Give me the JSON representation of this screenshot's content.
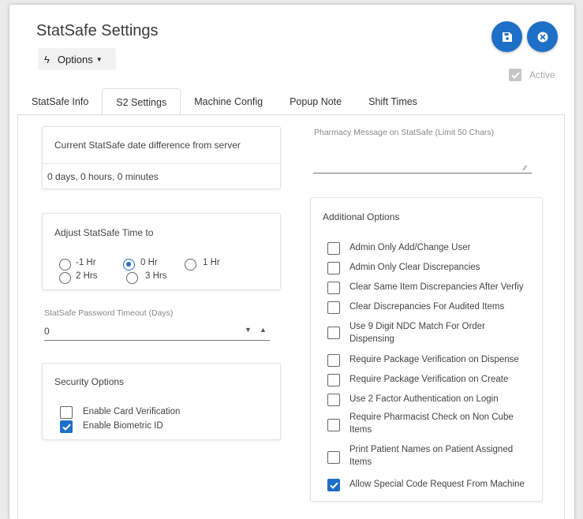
{
  "header": {
    "title": "StatSafe Settings",
    "options_label": "Options",
    "active_label": "Active"
  },
  "tabs": [
    {
      "label": "StatSafe Info"
    },
    {
      "label": "S2 Settings"
    },
    {
      "label": "Machine Config"
    },
    {
      "label": "Popup Note"
    },
    {
      "label": "Shift Times"
    }
  ],
  "date_diff": {
    "title": "Current StatSafe date difference from server",
    "value": "0 days, 0 hours, 0 minutes"
  },
  "adjust_time": {
    "title": "Adjust StatSafe Time to",
    "options": [
      "-1 Hr",
      "0 Hr",
      "1 Hr",
      "2 Hrs",
      "3 Hrs"
    ],
    "selected": "0 Hr"
  },
  "password_timeout": {
    "label": "StatSafe Password Timeout (Days)",
    "value": "0"
  },
  "security": {
    "title": "Security Options",
    "items": [
      {
        "label": "Enable Card Verification",
        "checked": false
      },
      {
        "label": "Enable Biometric ID",
        "checked": true
      }
    ]
  },
  "pharmacy_message": {
    "label": "Pharmacy Message on StatSafe (Limit 50 Chars)",
    "value": ""
  },
  "additional": {
    "title": "Additional Options",
    "items": [
      {
        "label": "Admin Only Add/Change User",
        "checked": false
      },
      {
        "label": "Admin Only Clear Discrepancies",
        "checked": false
      },
      {
        "label": "Clear Same Item Discrepancies After Verfiy",
        "checked": false
      },
      {
        "label": "Clear Discrepancies For Audited Items",
        "checked": false
      },
      {
        "label": "Use 9 Digit NDC Match For Order Dispensing",
        "checked": false
      },
      {
        "label": "Require Package Verification on Dispense",
        "checked": false
      },
      {
        "label": "Require Package Verification on Create",
        "checked": false
      },
      {
        "label": "Use 2 Factor Authentication on Login",
        "checked": false
      },
      {
        "label": "Require Pharmacist Check on Non Cube Items",
        "checked": false
      },
      {
        "label": "Print Patient Names on Patient Assigned Items",
        "checked": false
      },
      {
        "label": "Allow Special Code Request From Machine",
        "checked": true
      }
    ]
  },
  "colors": {
    "accent": "#1e6fc7",
    "disabled": "#c6c6c6"
  },
  "icons": {
    "options": "bolt-icon",
    "save": "floppy-disk-icon",
    "close": "close-circle-icon"
  }
}
